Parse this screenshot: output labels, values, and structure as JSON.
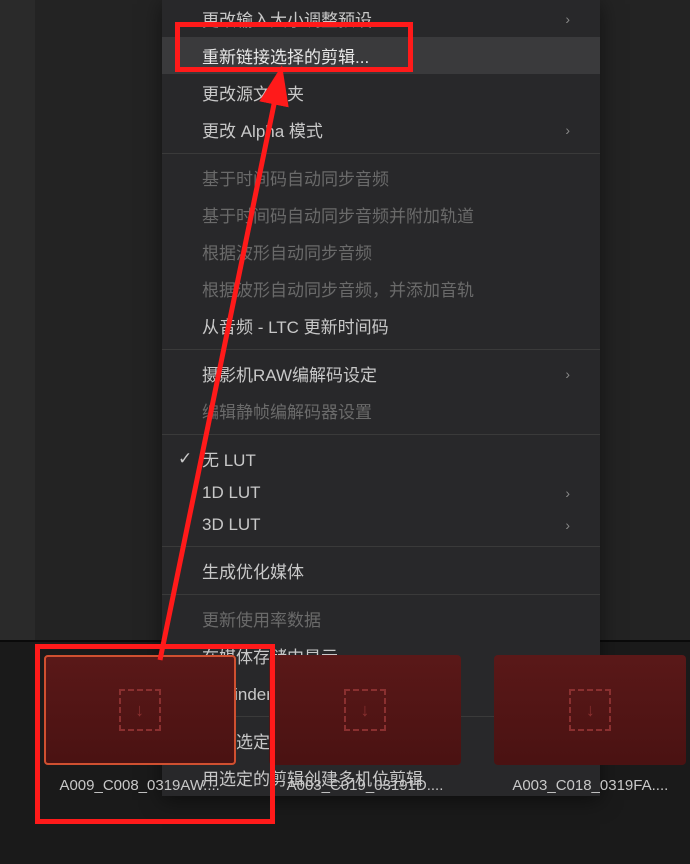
{
  "menu": {
    "items": [
      {
        "label": "更改输入大小调整预设",
        "hasSubmenu": true,
        "disabled": false,
        "divider": false
      },
      {
        "label": "重新链接选择的剪辑...",
        "selected": true,
        "disabled": false,
        "divider": false
      },
      {
        "label": "更改源文件夹",
        "disabled": false,
        "divider": false
      },
      {
        "label": "更改 Alpha 模式",
        "hasSubmenu": true,
        "disabled": false,
        "divider": false
      },
      {
        "divider": true
      },
      {
        "label": "基于时间码自动同步音频",
        "disabled": true,
        "divider": false
      },
      {
        "label": "基于时间码自动同步音频并附加轨道",
        "disabled": true,
        "divider": false
      },
      {
        "label": "根据波形自动同步音频",
        "disabled": true,
        "divider": false
      },
      {
        "label": "根据波形自动同步音频，并添加音轨",
        "disabled": true,
        "divider": false
      },
      {
        "label": "从音频 - LTC 更新时间码",
        "disabled": false,
        "divider": false
      },
      {
        "divider": true
      },
      {
        "label": "摄影机RAW编解码设定",
        "hasSubmenu": true,
        "disabled": false,
        "divider": false
      },
      {
        "label": "编辑静帧编解码器设置",
        "disabled": true,
        "divider": false
      },
      {
        "divider": true
      },
      {
        "label": "无 LUT",
        "checked": true,
        "disabled": false,
        "divider": false
      },
      {
        "label": "1D LUT",
        "hasSubmenu": true,
        "disabled": false,
        "divider": false
      },
      {
        "label": "3D LUT",
        "hasSubmenu": true,
        "disabled": false,
        "divider": false
      },
      {
        "divider": true
      },
      {
        "label": "生成优化媒体",
        "disabled": false,
        "divider": false
      },
      {
        "divider": true
      },
      {
        "label": "更新使用率数据",
        "disabled": true,
        "divider": false
      },
      {
        "label": "在媒体存储中显示",
        "disabled": false,
        "divider": false
      },
      {
        "label": "在 Finder 中显示",
        "disabled": false,
        "divider": false
      },
      {
        "divider": true
      },
      {
        "label": "使用选定的剪辑创建时间线",
        "disabled": false,
        "divider": false
      },
      {
        "label": "用选定的剪辑创建多机位剪辑",
        "disabled": false,
        "divider": false
      }
    ]
  },
  "thumbnails": [
    {
      "label": "A009_C008_0319AW....",
      "active": true
    },
    {
      "label": "A003_C019_03191D....",
      "active": false
    },
    {
      "label": "A003_C018_0319FA....",
      "active": false
    }
  ],
  "annotation": {
    "highlight_color": "#ff1a1a"
  }
}
